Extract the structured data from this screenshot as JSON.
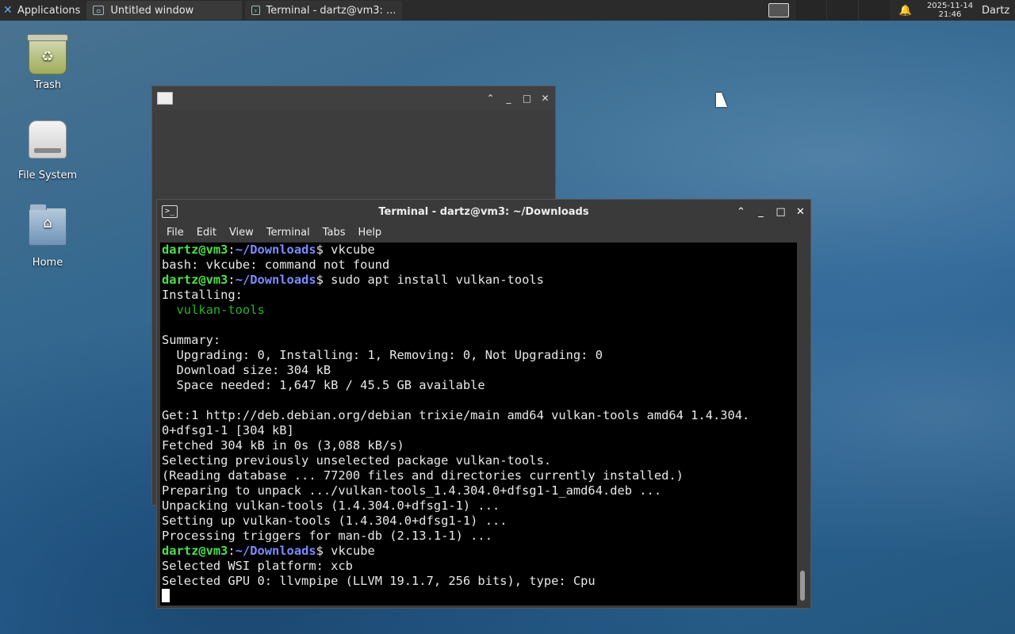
{
  "panel": {
    "applications_label": "Applications",
    "tasks": [
      {
        "label": "Untitled window"
      },
      {
        "label": "Terminal - dartz@vm3: ..."
      }
    ],
    "clock_date": "2025-11-14",
    "clock_time": "21:46",
    "user": "Dartz"
  },
  "desktop": {
    "icons": [
      {
        "label": "Trash"
      },
      {
        "label": "File System"
      },
      {
        "label": "Home"
      }
    ]
  },
  "terminal": {
    "title": "Terminal - dartz@vm3: ~/Downloads",
    "menu": [
      "File",
      "Edit",
      "View",
      "Terminal",
      "Tabs",
      "Help"
    ],
    "prompt_user": "dartz@vm3",
    "prompt_path": "~/Downloads",
    "lines": [
      {
        "type": "prompt",
        "cmd": " vkcube"
      },
      {
        "type": "text",
        "text": "bash: vkcube: command not found"
      },
      {
        "type": "prompt",
        "cmd": " sudo apt install vulkan-tools"
      },
      {
        "type": "text",
        "text": "Installing:"
      },
      {
        "type": "pkg",
        "text": "  vulkan-tools"
      },
      {
        "type": "text",
        "text": ""
      },
      {
        "type": "text",
        "text": "Summary:"
      },
      {
        "type": "text",
        "text": "  Upgrading: 0, Installing: 1, Removing: 0, Not Upgrading: 0"
      },
      {
        "type": "text",
        "text": "  Download size: 304 kB"
      },
      {
        "type": "text",
        "text": "  Space needed: 1,647 kB / 45.5 GB available"
      },
      {
        "type": "text",
        "text": ""
      },
      {
        "type": "text",
        "text": "Get:1 http://deb.debian.org/debian trixie/main amd64 vulkan-tools amd64 1.4.304."
      },
      {
        "type": "text",
        "text": "0+dfsg1-1 [304 kB]"
      },
      {
        "type": "text",
        "text": "Fetched 304 kB in 0s (3,088 kB/s)"
      },
      {
        "type": "text",
        "text": "Selecting previously unselected package vulkan-tools."
      },
      {
        "type": "text",
        "text": "(Reading database ... 77200 files and directories currently installed.)"
      },
      {
        "type": "text",
        "text": "Preparing to unpack .../vulkan-tools_1.4.304.0+dfsg1-1_amd64.deb ..."
      },
      {
        "type": "text",
        "text": "Unpacking vulkan-tools (1.4.304.0+dfsg1-1) ..."
      },
      {
        "type": "text",
        "text": "Setting up vulkan-tools (1.4.304.0+dfsg1-1) ..."
      },
      {
        "type": "text",
        "text": "Processing triggers for man-db (2.13.1-1) ..."
      },
      {
        "type": "prompt",
        "cmd": " vkcube"
      },
      {
        "type": "text",
        "text": "Selected WSI platform: xcb"
      },
      {
        "type": "text",
        "text": "Selected GPU 0: llvmpipe (LLVM 19.1.7, 256 bits), type: Cpu"
      }
    ]
  },
  "icons": {
    "applications": "xfce-logo-icon",
    "notification": "bell-icon",
    "files": "file-manager-icon"
  }
}
